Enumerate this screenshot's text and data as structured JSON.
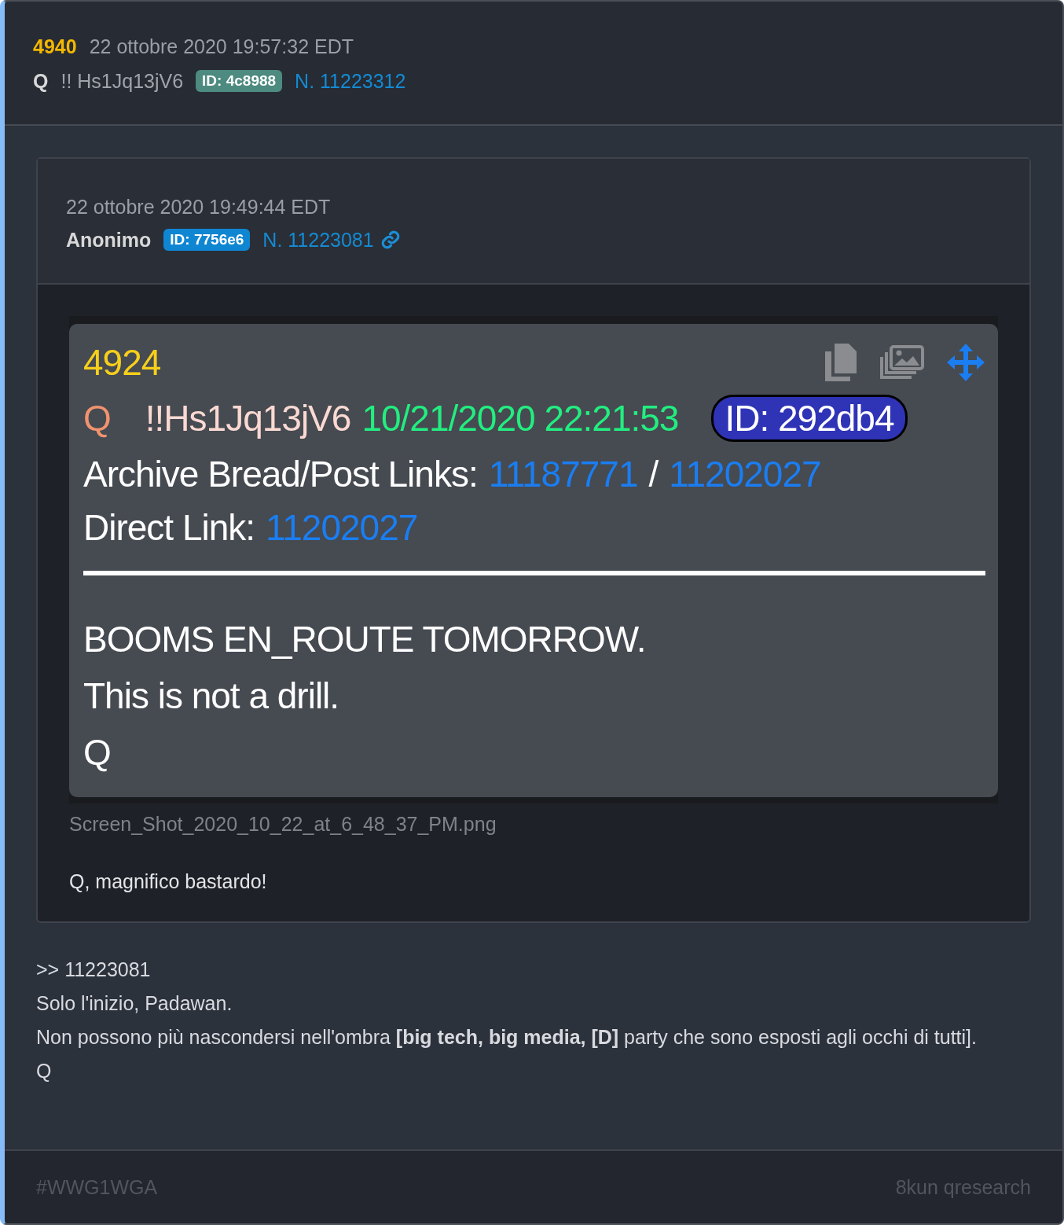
{
  "post": {
    "number": "4940",
    "date": "22 ottobre 2020 19:57:32 EDT",
    "author": "Q",
    "tripcode": "!! Hs1Jq13jV6",
    "id_badge": "ID: 4c8988",
    "post_no": "N. 11223312"
  },
  "quoted": {
    "date": "22 ottobre 2020 19:49:44 EDT",
    "author": "Anonimo",
    "id_badge": "ID: 7756e6",
    "post_no": "N. 11223081",
    "image": {
      "number": "4924",
      "author": "Q",
      "tripcode": "!!Hs1Jq13jV6",
      "datetime": "10/21/2020 22:21:53",
      "id": "ID: 292db4",
      "archive_label": "Archive Bread/Post Links:",
      "archive_links": [
        "11187771",
        "11202027"
      ],
      "separator": "/",
      "direct_label": "Direct Link:",
      "direct_link": "11202027",
      "body": [
        "BOOMS EN_ROUTE TOMORROW.",
        "This is not a drill.",
        "Q"
      ]
    },
    "filename": "Screen_Shot_2020_10_22_at_6_48_37_PM.png",
    "text": "Q, magnifico bastardo!"
  },
  "reply": [
    ">> 11223081",
    "Solo l'inizio, Padawan.",
    "Non possono più nascondersi nell'ombra **[big tech, big media, [D]** party che sono esposti agli occhi di tutti].",
    "Q"
  ],
  "footer": {
    "hashtag": "#WWG1WGA",
    "source": "8kun qresearch"
  }
}
